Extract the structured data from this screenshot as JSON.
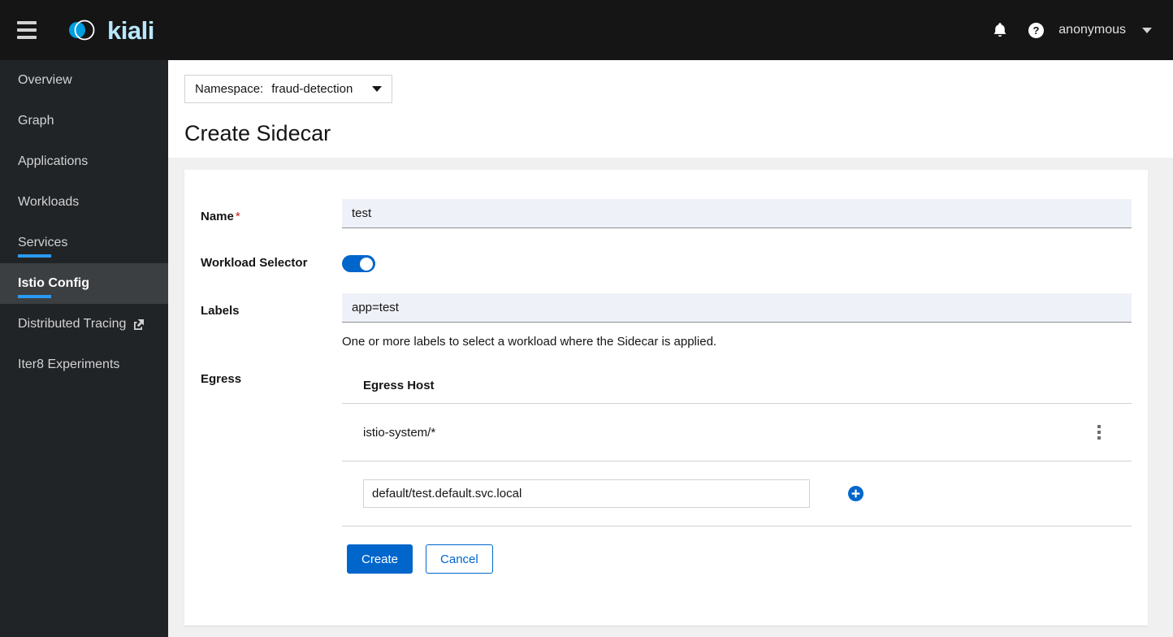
{
  "masthead": {
    "brand_name": "kiali",
    "menu_icon": "hamburger-icon",
    "bell_icon": "bell-icon",
    "help_icon": "help-circle-icon",
    "user": "anonymous",
    "user_caret_icon": "chevron-down-icon"
  },
  "sidebar": {
    "items": [
      {
        "label": "Overview",
        "active": false,
        "underlined": false,
        "external": false
      },
      {
        "label": "Graph",
        "active": false,
        "underlined": false,
        "external": false
      },
      {
        "label": "Applications",
        "active": false,
        "underlined": false,
        "external": false
      },
      {
        "label": "Workloads",
        "active": false,
        "underlined": false,
        "external": false
      },
      {
        "label": "Services",
        "active": false,
        "underlined": true,
        "external": false
      },
      {
        "label": "Istio Config",
        "active": true,
        "underlined": true,
        "external": false
      },
      {
        "label": "Distributed Tracing",
        "active": false,
        "underlined": false,
        "external": true
      },
      {
        "label": "Iter8 Experiments",
        "active": false,
        "underlined": false,
        "external": false
      }
    ]
  },
  "page": {
    "namespace_label": "Namespace:",
    "namespace_value": "fraud-detection",
    "title": "Create Sidecar"
  },
  "form": {
    "name": {
      "label": "Name",
      "required_marker": "*",
      "value": "test"
    },
    "workload_selector": {
      "label": "Workload Selector",
      "enabled": true
    },
    "labels": {
      "label": "Labels",
      "value": "app=test",
      "help": "One or more labels to select a workload where the Sidecar is applied."
    },
    "egress": {
      "label": "Egress",
      "column_header": "Egress Host",
      "rows": [
        {
          "host": "istio-system/*",
          "menu_icon": "kebab-menu-icon"
        }
      ],
      "new_host_value": "default/test.default.svc.local",
      "add_icon": "plus-circle-icon"
    }
  },
  "actions": {
    "create_label": "Create",
    "cancel_label": "Cancel"
  },
  "colors": {
    "accent_blue": "#0066cc",
    "nav_underline": "#2b9af3",
    "brand_text": "#b9e7fb",
    "required": "#c9190b",
    "masthead_bg": "#151515",
    "sidebar_bg": "#212427",
    "sidebar_active_bg": "#3c3f42",
    "page_bg": "#f0f0f0",
    "input_fill": "#eef1f7"
  }
}
